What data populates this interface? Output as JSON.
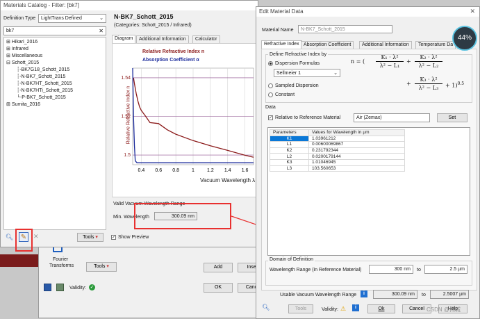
{
  "fourier": {
    "label_line1": "Fourier",
    "label_line2": "Transforms",
    "tools_label": "Tools",
    "add_label": "Add",
    "insert_label": "Inse",
    "ok_label": "OK",
    "cancel_label": "Canc",
    "validity_label": "Validity:"
  },
  "catalog": {
    "title": "Materials Catalog - Filter: [bk7]",
    "definition_type_label": "Definition Type",
    "definition_type_value": "LightTrans Defined",
    "search_value": "bk7",
    "tree": [
      "Hikari_2016",
      "Infrared",
      "Miscellaneous",
      "Schott_2015",
      "BK7G18_Schott_2015",
      "N-BK7_Schott_2015",
      "N-BK7HT_Schott_2015",
      "N-BK7HTi_Schott_2015",
      "P-BK7_Schott_2015",
      "Sumita_2016"
    ],
    "material_name": "N-BK7_Schott_2015",
    "categories": "(Categories: Schott_2015 / Infrared)",
    "tabs": [
      "Diagram",
      "Additional Information",
      "Calculator"
    ],
    "legend_n": "Relative Refractive Index n",
    "legend_alpha": "Absorption Coefficient α",
    "y_axis_label": "Relative Refractive Index n",
    "x_axis_label": "Vacuum Wavelength λ",
    "x_ticks": [
      "0.4",
      "0.6",
      "0.8",
      "1",
      "1.2",
      "1.4",
      "1.6"
    ],
    "y_ticks": [
      "1.54",
      "1.52",
      "1.5"
    ],
    "valid_range_title": "Valid Vacuum Wavelength Range",
    "min_wavelength_label": "Min. Wavelength",
    "min_wavelength_value": "300.09 nm",
    "tools_label": "Tools",
    "show_preview_label": "Show Preview",
    "colors": {
      "n": "#8b1a1a",
      "alpha": "#1a2a9b"
    }
  },
  "chart_data": {
    "type": "line",
    "title": "",
    "xlabel": "Vacuum Wavelength λ",
    "ylabel": "Relative Refractive Index n",
    "xlim": [
      0.3,
      1.7
    ],
    "ylim": [
      1.495,
      1.545
    ],
    "series": [
      {
        "name": "Relative Refractive Index n",
        "x": [
          0.31,
          0.32,
          0.34,
          0.36,
          0.38,
          0.4,
          0.45,
          0.5,
          0.6,
          0.7,
          0.8,
          1.0,
          1.2,
          1.4,
          1.6,
          1.7
        ],
        "y": [
          1.54,
          1.537,
          1.532,
          1.528,
          1.525,
          1.5231,
          1.5201,
          1.5168,
          1.5163,
          1.5131,
          1.5108,
          1.5075,
          1.5048,
          1.5024,
          1.4999,
          1.4989
        ]
      },
      {
        "name": "Absorption Coefficient α",
        "x": [
          0.3,
          0.31,
          0.32,
          0.33,
          0.35,
          0.4,
          0.8,
          1.2,
          1.6,
          1.7
        ],
        "y": [
          1.545,
          1.52,
          1.505,
          1.497,
          1.496,
          1.496,
          1.496,
          1.496,
          1.496,
          1.496
        ]
      }
    ]
  },
  "edit": {
    "title": "Edit Material Data",
    "material_name_label": "Material Name",
    "material_name_value": "N-BK7_Schott_2015",
    "tabs": [
      "Refractive Index",
      "Absorption Coefficient",
      "Additional Information",
      "Temperature Da"
    ],
    "define_label": "Define Refractive Index by",
    "dispersion_label": "Dispersion Formulas",
    "formula_value": "Sellmeier 1",
    "sampled_label": "Sampled Dispersion",
    "constant_label": "Constant",
    "data_label": "Data",
    "relative_label": "Relative to Reference Material",
    "reference_value": "Air (Zemax)",
    "set_label": "Set",
    "table_headers": [
      "Parameters",
      "Values for Wavelength in µm"
    ],
    "params": [
      {
        "name": "K1",
        "value": "1.03961212"
      },
      {
        "name": "L1",
        "value": "0.00600069867"
      },
      {
        "name": "K2",
        "value": "0.231792344"
      },
      {
        "name": "L2",
        "value": "0.0200179144"
      },
      {
        "name": "K3",
        "value": "1.01046945"
      },
      {
        "name": "L3",
        "value": "103.560653"
      }
    ],
    "domain_label": "Domain of Definition",
    "wl_range_label": "Wavelength Range (in Reference Material)",
    "wl_from": "300 nm",
    "wl_to_label": "to",
    "wl_to": "2.5 µm",
    "usable_label": "Usable Vacuum Wavelength Range",
    "usable_from": "300.09 nm",
    "usable_to_label": "to",
    "usable_to": "2.5007 µm",
    "tools_label": "Tools",
    "validity_label": "Validity:",
    "ok_label": "Ok",
    "cancel_label": "Cancel",
    "help_label": "Help",
    "badge_value": "44%",
    "watermark": "CSDN @揭城"
  }
}
